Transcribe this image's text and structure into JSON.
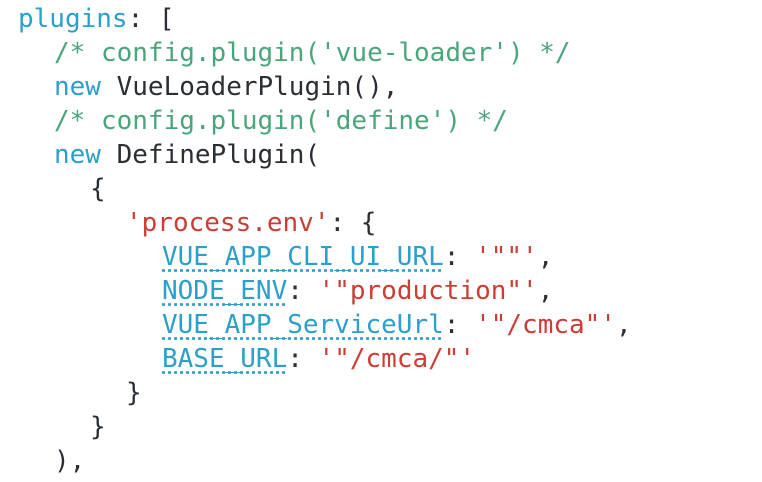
{
  "editor": {
    "lines": [
      {
        "indent": 0,
        "tokens": [
          {
            "t": "plugins",
            "c": "kw"
          },
          {
            "t": ": [",
            "c": "pun"
          }
        ]
      },
      {
        "indent": 1,
        "tokens": [
          {
            "t": "/* config.plugin('vue-loader') */",
            "c": "cm"
          }
        ]
      },
      {
        "indent": 1,
        "tokens": [
          {
            "t": "new",
            "c": "kw"
          },
          {
            "t": " VueLoaderPlugin(),",
            "c": "plain"
          }
        ]
      },
      {
        "indent": 1,
        "tokens": [
          {
            "t": "/* config.plugin('define') */",
            "c": "cm"
          }
        ]
      },
      {
        "indent": 1,
        "tokens": [
          {
            "t": "new",
            "c": "kw"
          },
          {
            "t": " DefinePlugin(",
            "c": "plain"
          }
        ]
      },
      {
        "indent": 2,
        "tokens": [
          {
            "t": "{",
            "c": "pun"
          }
        ]
      },
      {
        "indent": 3,
        "tokens": [
          {
            "t": "'process.env'",
            "c": "str"
          },
          {
            "t": ": {",
            "c": "pun"
          }
        ]
      },
      {
        "indent": 4,
        "tokens": [
          {
            "t": "VUE_APP_CLI_UI_URL",
            "c": "key"
          },
          {
            "t": ": ",
            "c": "pun"
          },
          {
            "t": "'\"\"'",
            "c": "str"
          },
          {
            "t": ",",
            "c": "pun"
          }
        ]
      },
      {
        "indent": 4,
        "tokens": [
          {
            "t": "NODE_ENV",
            "c": "key"
          },
          {
            "t": ": ",
            "c": "pun"
          },
          {
            "t": "'\"production\"'",
            "c": "str"
          },
          {
            "t": ",",
            "c": "pun"
          }
        ]
      },
      {
        "indent": 4,
        "tokens": [
          {
            "t": "VUE_APP_ServiceUrl",
            "c": "key"
          },
          {
            "t": ": ",
            "c": "pun"
          },
          {
            "t": "'\"/cmca\"'",
            "c": "str"
          },
          {
            "t": ",",
            "c": "pun"
          }
        ]
      },
      {
        "indent": 4,
        "tokens": [
          {
            "t": "BASE_URL",
            "c": "key"
          },
          {
            "t": ": ",
            "c": "pun"
          },
          {
            "t": "'\"/cmca/\"'",
            "c": "str"
          }
        ]
      },
      {
        "indent": 3,
        "tokens": [
          {
            "t": "}",
            "c": "pun"
          }
        ]
      },
      {
        "indent": 2,
        "tokens": [
          {
            "t": "}",
            "c": "pun"
          }
        ]
      },
      {
        "indent": 1,
        "tokens": [
          {
            "t": "),",
            "c": "pun"
          }
        ]
      }
    ],
    "colors": {
      "keyword": "#2c9fca",
      "comment": "#4aa57a",
      "string": "#cc3d35",
      "text": "#2b2f33",
      "background": "#ffffff"
    }
  }
}
